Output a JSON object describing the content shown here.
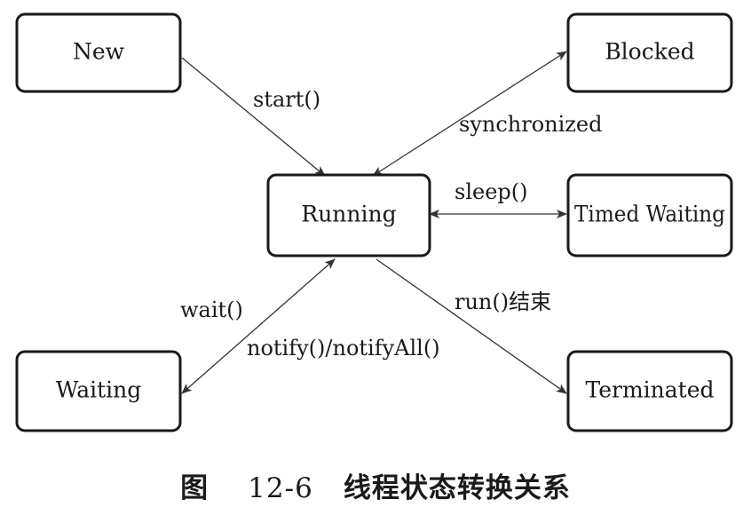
{
  "states": {
    "new": "New",
    "blocked": "Blocked",
    "running": "Running",
    "timed_waiting": "Timed Waiting",
    "waiting": "Waiting",
    "terminated": "Terminated"
  },
  "transitions": {
    "start": "start()",
    "synchronized": "synchronized",
    "sleep": "sleep()",
    "wait": "wait()",
    "notify": "notify()/notifyAll()",
    "run_end": "run()结束"
  },
  "caption": {
    "figure_word": "图",
    "figure_number": "12-6",
    "title": "线程状态转换关系"
  },
  "colors": {
    "stroke": "#1a1a1a",
    "background": "#ffffff"
  }
}
